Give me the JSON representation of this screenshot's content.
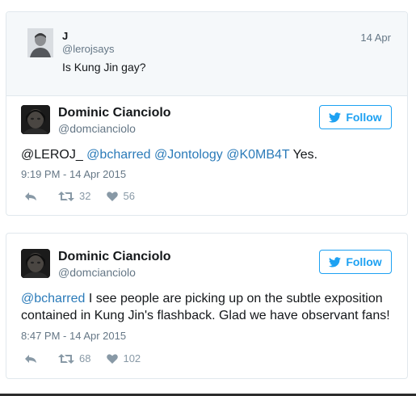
{
  "parent_tweet": {
    "name": "J",
    "handle": "@lerojsays",
    "date": "14 Apr",
    "text": "Is Kung Jin gay?"
  },
  "tweets": [
    {
      "name": "Dominic Cianciolo",
      "handle": "@domcianciolo",
      "follow_label": "Follow",
      "mentions": [
        "@LEROJ_",
        "@bcharred",
        "@Jontology",
        "@K0MB4T"
      ],
      "text_tail": "Yes.",
      "time": "9:19 PM - 14 Apr 2015",
      "retweets": "32",
      "likes": "56"
    },
    {
      "name": "Dominic Cianciolo",
      "handle": "@domcianciolo",
      "follow_label": "Follow",
      "mention": "@bcharred",
      "text_line1_tail": "I see people are picking up on the subtle exposition",
      "text_line2": "contained in Kung Jin's flashback. Glad we have observant fans!",
      "time": "8:47 PM - 14 Apr 2015",
      "retweets": "68",
      "likes": "102"
    }
  ],
  "icons": {
    "follow": "twitter-bird-icon",
    "reply": "reply-icon",
    "retweet": "retweet-icon",
    "like": "heart-icon"
  },
  "colors": {
    "accent": "#1da1f2",
    "mention": "#2b7bb9",
    "muted": "#657786",
    "action_icon": "#8899a6",
    "parent_bg": "#f5f8fa"
  }
}
